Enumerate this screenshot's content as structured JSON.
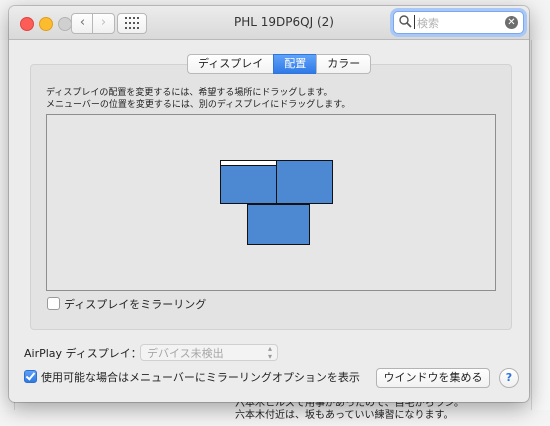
{
  "window": {
    "title": "PHL 19DP6QJ (2)"
  },
  "search": {
    "placeholder": "検索",
    "clear": "✕"
  },
  "nav": {
    "back": "‹",
    "forward": "›"
  },
  "tabs": [
    {
      "label": "ディスプレイ",
      "active": false
    },
    {
      "label": "配置",
      "active": true
    },
    {
      "label": "カラー",
      "active": false
    }
  ],
  "arrangement": {
    "line1": "ディスプレイの配置を変更するには、希望する場所にドラッグします。",
    "line2": "メニューバーの位置を変更するには、別のディスプレイにドラッグします。",
    "display_color": "#4d88d2"
  },
  "mirror": {
    "label": "ディスプレイをミラーリング",
    "checked": false
  },
  "airplay": {
    "label": "AirPlay ディスプレイ：",
    "value": "デバイス未検出"
  },
  "show_mirror_options": {
    "label": "使用可能な場合はメニューバーにミラーリングオプションを表示",
    "checked": true
  },
  "buttons": {
    "gather": "ウインドウを集める",
    "help": "?"
  },
  "background_app": {
    "bottom_line1": "六本木ヒルズで用事があったので、自宅からラン。",
    "bottom_line2": "六本木付近は、坂もあっていい練習になります。"
  }
}
